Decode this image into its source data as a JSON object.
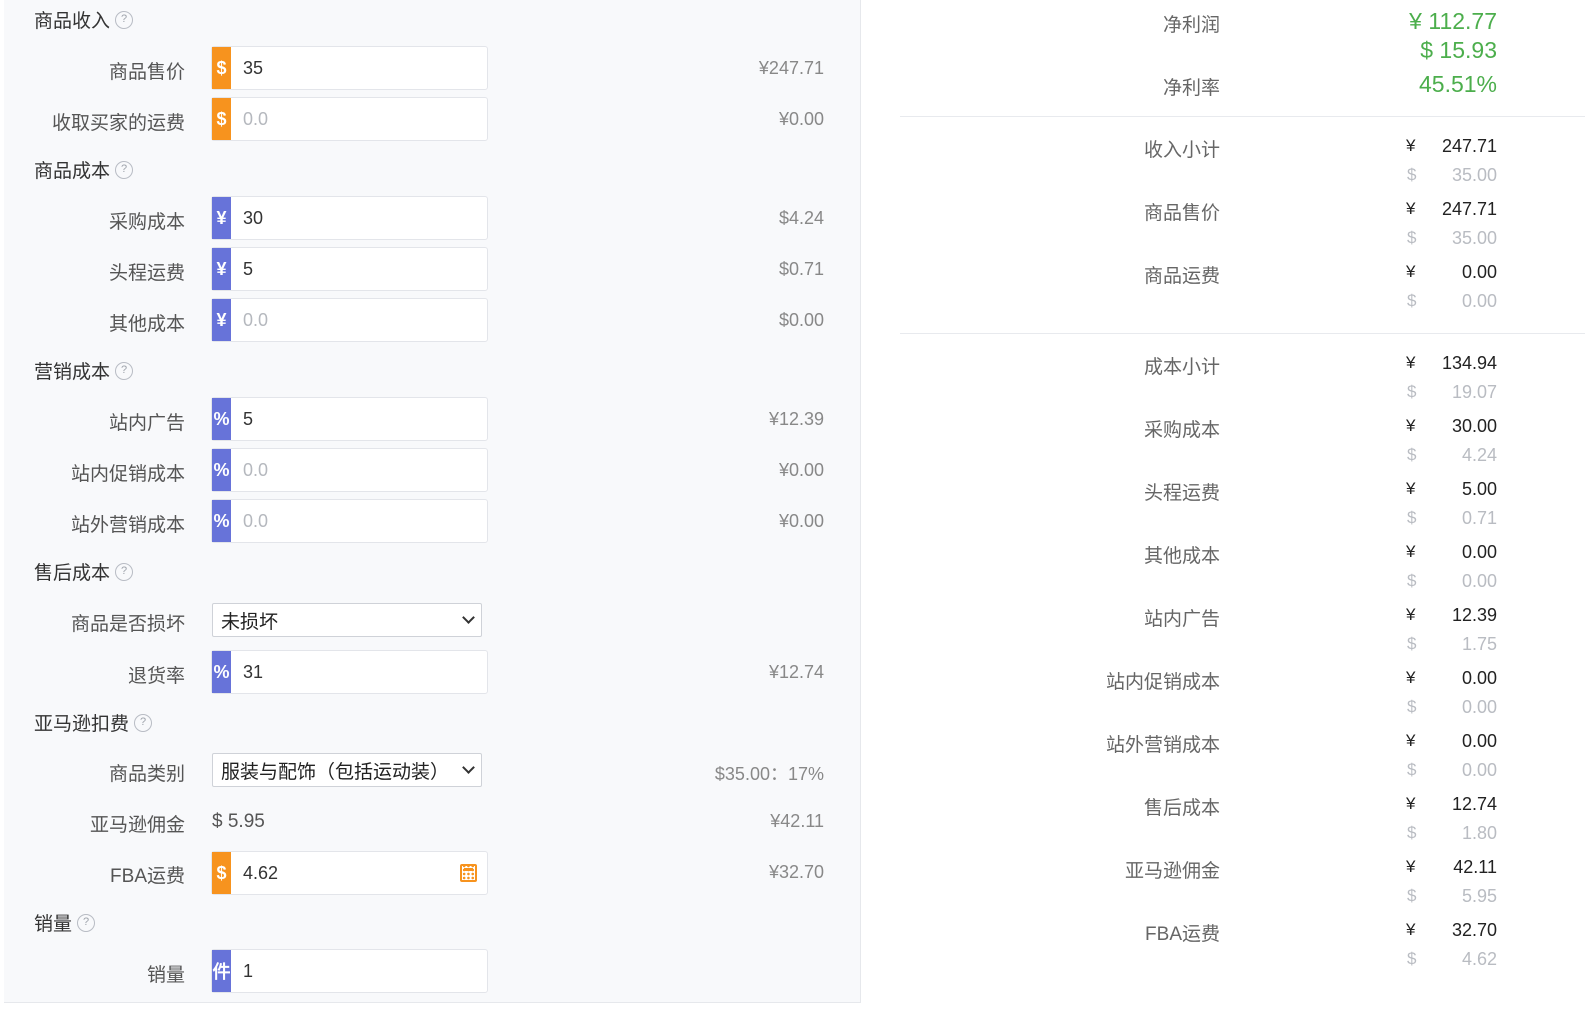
{
  "sections": {
    "income": "商品收入",
    "cost": "商品成本",
    "marketing": "营销成本",
    "after_sales": "售后成本",
    "amazon_fees": "亚马逊扣费",
    "sales": "销量"
  },
  "fields": {
    "sale_price": {
      "label": "商品售价",
      "addon": "$",
      "value": "35",
      "converted": "¥247.71"
    },
    "buyer_shipping": {
      "label": "收取买家的运费",
      "addon": "$",
      "placeholder": "0.0",
      "converted": "¥0.00"
    },
    "purchase_cost": {
      "label": "采购成本",
      "addon": "¥",
      "value": "30",
      "converted": "$4.24"
    },
    "first_leg": {
      "label": "头程运费",
      "addon": "¥",
      "value": "5",
      "converted": "$0.71"
    },
    "other_cost": {
      "label": "其他成本",
      "addon": "¥",
      "placeholder": "0.0",
      "converted": "$0.00"
    },
    "onsite_ads": {
      "label": "站内广告",
      "addon": "%",
      "value": "5",
      "converted": "¥12.39"
    },
    "onsite_promo": {
      "label": "站内促销成本",
      "addon": "%",
      "placeholder": "0.0",
      "converted": "¥0.00"
    },
    "offsite_marketing": {
      "label": "站外营销成本",
      "addon": "%",
      "placeholder": "0.0",
      "converted": "¥0.00"
    },
    "damaged": {
      "label": "商品是否损坏",
      "selected": "未损坏"
    },
    "return_rate": {
      "label": "退货率",
      "addon": "%",
      "value": "31",
      "converted": "¥12.74"
    },
    "category": {
      "label": "商品类别",
      "selected": "服装与配饰（包括运动装）",
      "converted": "$35.00：17%"
    },
    "commission": {
      "label": "亚马逊佣金",
      "value": "$ 5.95",
      "converted": "¥42.11"
    },
    "fba_fee": {
      "label": "FBA运费",
      "addon": "$",
      "value": "4.62",
      "converted": "¥32.70"
    },
    "quantity": {
      "label": "销量",
      "addon": "件",
      "value": "1"
    }
  },
  "summary": {
    "net_profit": {
      "label": "净利润",
      "cny": "¥ 112.77",
      "usd": "$ 15.93"
    },
    "net_margin": {
      "label": "净利率",
      "value": "45.51%"
    },
    "cny_symbol": "¥",
    "usd_symbol": "$",
    "items": [
      {
        "label": "收入小计",
        "cny": "247.71",
        "usd": "35.00"
      },
      {
        "label": "商品售价",
        "cny": "247.71",
        "usd": "35.00"
      },
      {
        "label": "商品运费",
        "cny": "0.00",
        "usd": "0.00"
      },
      {
        "label": "成本小计",
        "cny": "134.94",
        "usd": "19.07"
      },
      {
        "label": "采购成本",
        "cny": "30.00",
        "usd": "4.24"
      },
      {
        "label": "头程运费",
        "cny": "5.00",
        "usd": "0.71"
      },
      {
        "label": "其他成本",
        "cny": "0.00",
        "usd": "0.00"
      },
      {
        "label": "站内广告",
        "cny": "12.39",
        "usd": "1.75"
      },
      {
        "label": "站内促销成本",
        "cny": "0.00",
        "usd": "0.00"
      },
      {
        "label": "站外营销成本",
        "cny": "0.00",
        "usd": "0.00"
      },
      {
        "label": "售后成本",
        "cny": "12.74",
        "usd": "1.80"
      },
      {
        "label": "亚马逊佣金",
        "cny": "42.11",
        "usd": "5.95"
      },
      {
        "label": "FBA运费",
        "cny": "32.70",
        "usd": "4.62"
      }
    ]
  },
  "colors": {
    "orange": "#f7931e",
    "blue": "#6773d9",
    "green": "#4cae4c"
  }
}
